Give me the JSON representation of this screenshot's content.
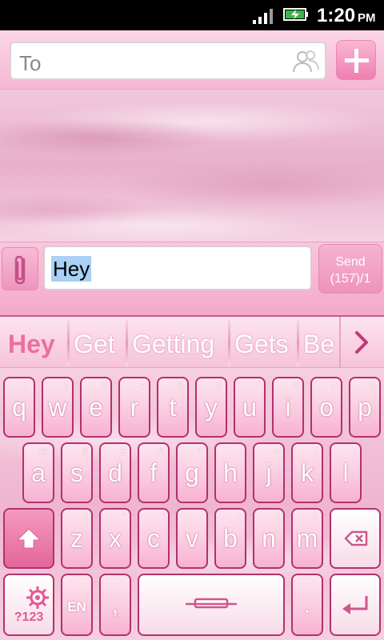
{
  "status_bar": {
    "time": "1:20",
    "ampm": "PM"
  },
  "header": {
    "to_placeholder": "To"
  },
  "compose": {
    "message_text": "Hey",
    "send_label": "Send",
    "send_count": "(157)/1"
  },
  "suggestions": [
    "Hey",
    "Get",
    "Getting",
    "Gets",
    "Be"
  ],
  "keyboard": {
    "row1": [
      {
        "k": "q",
        "s": "1"
      },
      {
        "k": "w",
        "s": "2"
      },
      {
        "k": "e",
        "s": "3"
      },
      {
        "k": "r",
        "s": "4"
      },
      {
        "k": "t",
        "s": "5"
      },
      {
        "k": "y",
        "s": "6"
      },
      {
        "k": "u",
        "s": "7"
      },
      {
        "k": "i",
        "s": "8"
      },
      {
        "k": "o",
        "s": "9"
      },
      {
        "k": "p",
        "s": "0"
      }
    ],
    "row2": [
      {
        "k": "a",
        "s": "@"
      },
      {
        "k": "s",
        "s": "#"
      },
      {
        "k": "d",
        "s": "$"
      },
      {
        "k": "f",
        "s": "&"
      },
      {
        "k": "g",
        "s": "*"
      },
      {
        "k": "h",
        "s": "-"
      },
      {
        "k": "j",
        "s": "+"
      },
      {
        "k": "k",
        "s": "("
      },
      {
        "k": "l",
        "s": ")"
      }
    ],
    "row3": [
      {
        "k": "z",
        "s": "!"
      },
      {
        "k": "x",
        "s": "\""
      },
      {
        "k": "c",
        "s": "'"
      },
      {
        "k": "v",
        "s": ":"
      },
      {
        "k": "b",
        "s": ";"
      },
      {
        "k": "n",
        "s": "/"
      },
      {
        "k": "m",
        "s": "?"
      }
    ],
    "symbols_label": "?123",
    "language_label": "EN",
    "comma": ",",
    "period": "."
  },
  "colors": {
    "accent": "#ea6f9f",
    "key_border": "#b3306e"
  }
}
